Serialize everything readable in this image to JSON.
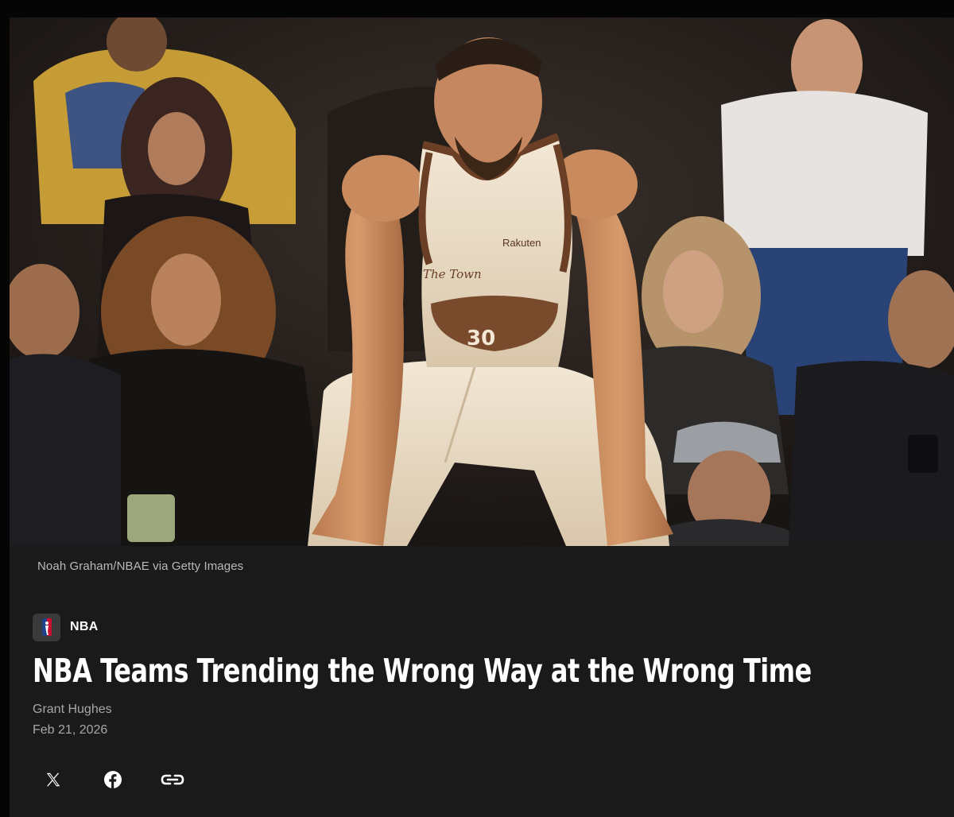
{
  "hero": {
    "jersey_text": "The Town",
    "jersey_number": "30",
    "sponsor": "Rakuten"
  },
  "caption": "Noah Graham/NBAE via Getty Images",
  "category": {
    "logo_icon": "nba-logo-icon",
    "label": "NBA"
  },
  "headline": "NBA Teams Trending the Wrong Way at the Wrong Time",
  "author": "Grant Hughes",
  "date": "Feb 21, 2026",
  "share": [
    {
      "icon": "x-logo-icon"
    },
    {
      "icon": "facebook-icon"
    },
    {
      "icon": "link-icon"
    }
  ],
  "colors": {
    "page_bg": "#050505",
    "card_bg": "#1a1a1a",
    "text_primary": "#ffffff",
    "text_secondary": "#a7a7a7",
    "jersey": "#efe3cf",
    "jersey_trim": "#6b3f25"
  }
}
